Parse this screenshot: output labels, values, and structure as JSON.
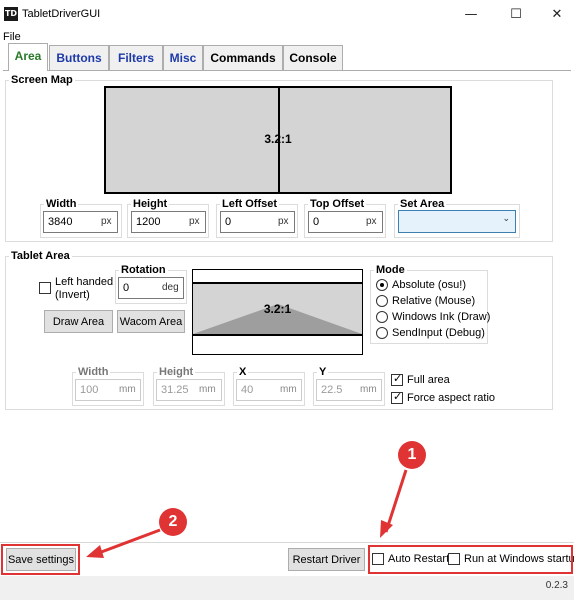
{
  "window": {
    "app_icon_text": "TD",
    "title": "TabletDriverGUI",
    "minimize_glyph": "—",
    "maximize_glyph": "☐",
    "close_glyph": "✕"
  },
  "menu": {
    "file": "File"
  },
  "tabs": [
    {
      "label": "Area",
      "color": "#2a7a2a"
    },
    {
      "label": "Buttons",
      "color": "#1d3aa8"
    },
    {
      "label": "Filters",
      "color": "#1d3aa8"
    },
    {
      "label": "Misc",
      "color": "#1d3aa8"
    },
    {
      "label": "Commands",
      "color": "#000000"
    },
    {
      "label": "Console",
      "color": "#000000"
    }
  ],
  "screen_map": {
    "title": "Screen Map",
    "ratio_label": "3.2:1",
    "width_label": "Width",
    "width_value": "3840",
    "width_unit": "px",
    "height_label": "Height",
    "height_value": "1200",
    "height_unit": "px",
    "left_offset_label": "Left Offset",
    "left_offset_value": "0",
    "left_offset_unit": "px",
    "top_offset_label": "Top Offset",
    "top_offset_value": "0",
    "top_offset_unit": "px",
    "set_area_label": "Set Area"
  },
  "tablet_area": {
    "title": "Tablet Area",
    "left_handed_label": "Left handed\n(Invert)",
    "rotation_label": "Rotation",
    "rotation_value": "0",
    "rotation_unit": "deg",
    "draw_area_button": "Draw Area",
    "wacom_area_button": "Wacom Area",
    "ratio_label": "3.2:1",
    "mode_title": "Mode",
    "modes": [
      {
        "label": "Absolute (osu!)",
        "checked": true
      },
      {
        "label": "Relative (Mouse)",
        "checked": false
      },
      {
        "label": "Windows Ink (Draw)",
        "checked": false
      },
      {
        "label": "SendInput (Debug)",
        "checked": false
      }
    ],
    "width_label": "Width",
    "width_value": "100",
    "width_unit": "mm",
    "height_label": "Height",
    "height_value": "31.25",
    "height_unit": "mm",
    "x_label": "X",
    "x_value": "40",
    "x_unit": "mm",
    "y_label": "Y",
    "y_value": "22.5",
    "y_unit": "mm",
    "full_area_label": "Full area",
    "force_aspect_label": "Force aspect ratio"
  },
  "footer": {
    "save_settings": "Save settings",
    "restart_driver": "Restart Driver",
    "auto_restart": "Auto Restart",
    "run_at_startup": "Run at Windows startup",
    "version": "0.2.3"
  },
  "annotations": {
    "callout_1": "1",
    "callout_2": "2",
    "color": "#e03434"
  }
}
